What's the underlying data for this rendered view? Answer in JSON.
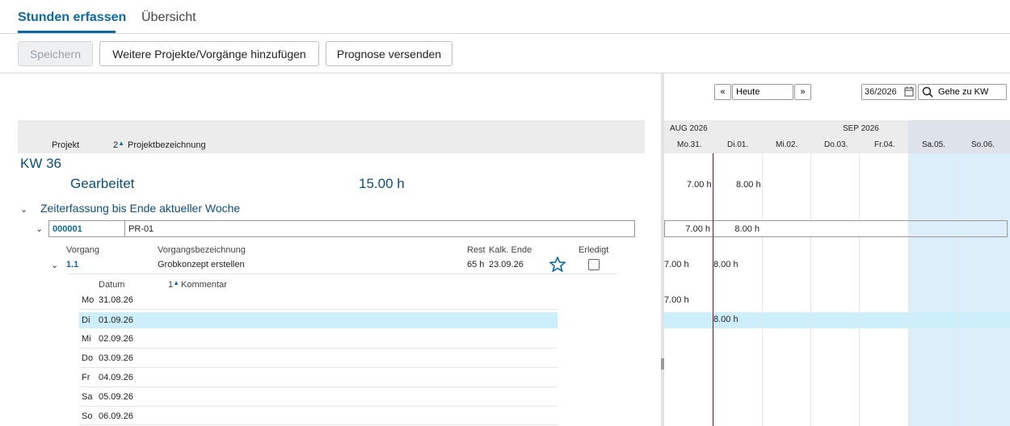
{
  "tabs": [
    {
      "label": "Stunden erfassen",
      "active": true
    },
    {
      "label": "Übersicht",
      "active": false
    }
  ],
  "toolbar": {
    "save_label": "Speichern",
    "add_label": "Weitere Projekte/Vorgänge hinzufügen",
    "forecast_label": "Prognose versenden"
  },
  "table_header": {
    "projekt": "Projekt",
    "sort_index": "2",
    "projektbezeichnung": "Projektbezeichnung"
  },
  "week": {
    "label": "KW 36",
    "worked_label": "Gearbeitet",
    "worked_total": "15.00 h",
    "section_label": "Zeiterfassung bis Ende aktueller Woche"
  },
  "project": {
    "id": "000001",
    "name": "PR-01"
  },
  "task_header": {
    "vorgang": "Vorgang",
    "bezeichnung": "Vorgangsbezeichnung",
    "rest": "Rest",
    "kalk_ende": "Kalk. Ende",
    "erledigt": "Erledigt"
  },
  "task": {
    "id": "1.1",
    "name": "Grobkonzept erstellen",
    "rest": "65 h",
    "kalk_ende": "23.09.26",
    "done": false
  },
  "entries_header": {
    "datum": "Datum",
    "sort_index": "1",
    "kommentar": "Kommentar"
  },
  "entries": [
    {
      "dow": "Mo",
      "date": "31.08.26"
    },
    {
      "dow": "Di",
      "date": "01.09.26"
    },
    {
      "dow": "Mi",
      "date": "02.09.26"
    },
    {
      "dow": "Do",
      "date": "03.09.26"
    },
    {
      "dow": "Fr",
      "date": "04.09.26"
    },
    {
      "dow": "Sa",
      "date": "05.09.26"
    },
    {
      "dow": "So",
      "date": "06.09.26"
    }
  ],
  "calendar": {
    "prev_label": "«",
    "today_label": "Heute",
    "next_label": "»",
    "week_value": "36/2026",
    "goto_label": "Gehe zu KW",
    "months": [
      "AUG 2026",
      "SEP 2026"
    ],
    "days": [
      "Mo.31.",
      "Di.01.",
      "Mi.02.",
      "Do.03.",
      "Fr.04.",
      "Sa.05.",
      "So.06."
    ],
    "week_totals": [
      "7.00 h",
      "8.00 h"
    ],
    "project_totals": [
      "7.00 h",
      "8.00 h"
    ],
    "task_totals": [
      "7.00 h",
      "8.00 h"
    ],
    "entry_mo": "7.00 h",
    "entry_di": "8.00 h"
  },
  "colors": {
    "accent": "#0b6aa6",
    "highlight": "#cdeefb",
    "weekend": "#ddeefb",
    "today_line": "#7b1030"
  }
}
